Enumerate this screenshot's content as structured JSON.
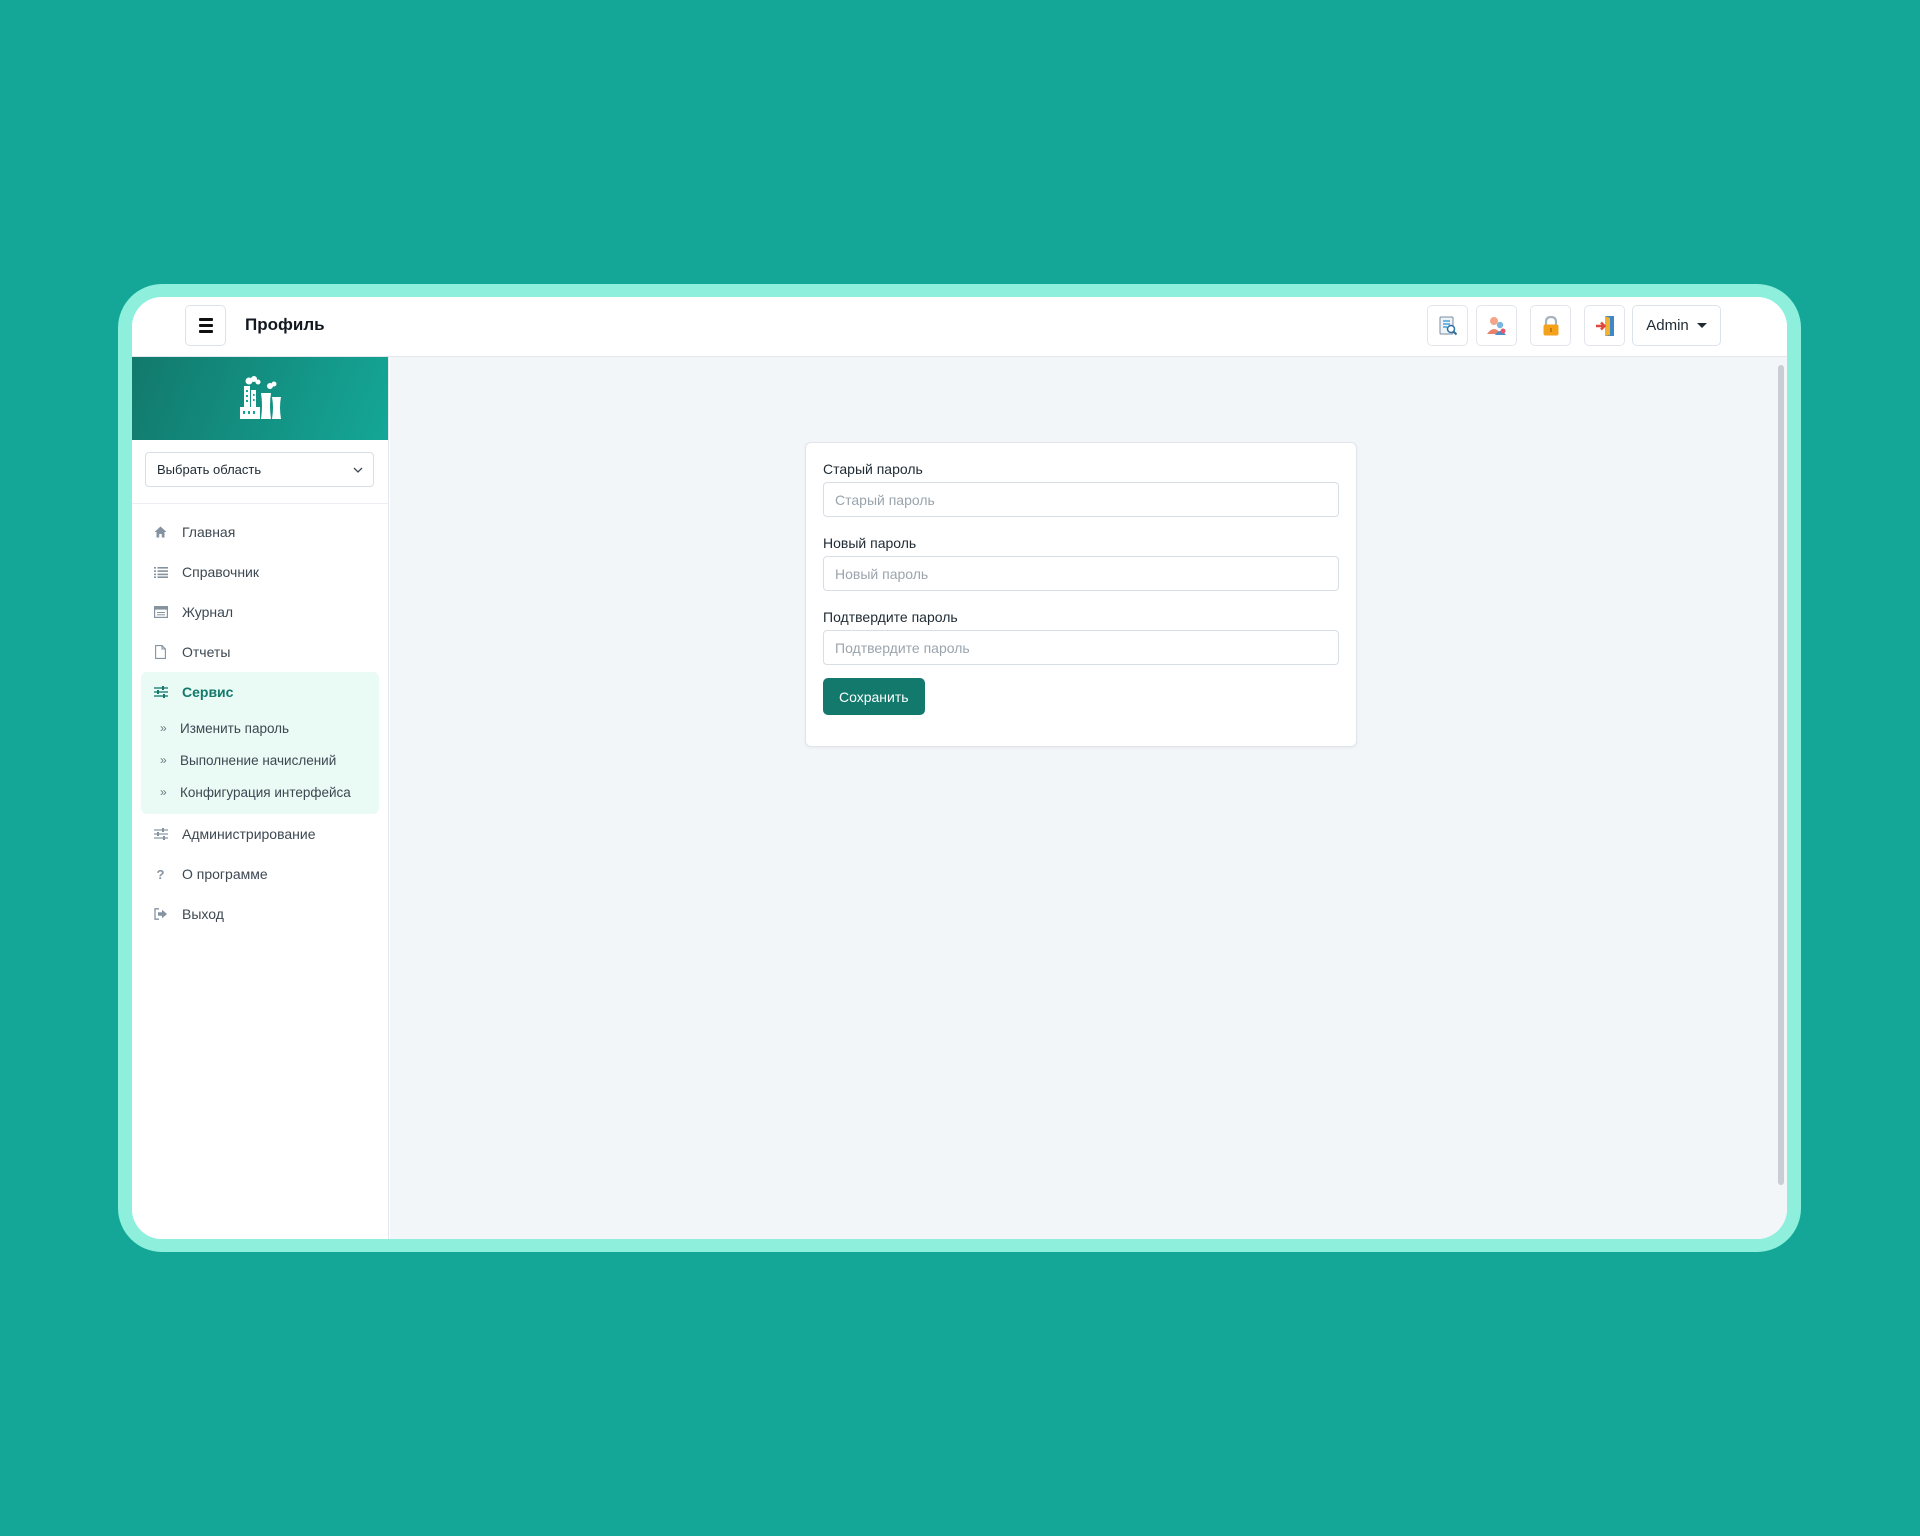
{
  "header": {
    "page_title": "Профиль",
    "user_label": "Admin",
    "tool_icons": [
      "report-search-icon",
      "users-icon",
      "lock-icon",
      "exit-door-icon"
    ]
  },
  "sidebar": {
    "region_select": {
      "value": "Выбрать область"
    },
    "items": [
      {
        "label": "Главная",
        "icon": "home-icon"
      },
      {
        "label": "Справочник",
        "icon": "list-icon"
      },
      {
        "label": "Журнал",
        "icon": "journal-icon"
      },
      {
        "label": "Отчеты",
        "icon": "file-icon"
      },
      {
        "label": "Сервис",
        "icon": "sliders-icon",
        "active": true,
        "children": [
          {
            "label": "Изменить пароль"
          },
          {
            "label": "Выполнение начислений"
          },
          {
            "label": "Конфигурация интерфейса"
          }
        ]
      },
      {
        "label": "Администрирование",
        "icon": "sliders-icon"
      },
      {
        "label": "О программе",
        "icon": "question-icon"
      },
      {
        "label": "Выход",
        "icon": "logout-icon"
      }
    ]
  },
  "form": {
    "old_password": {
      "label": "Старый пароль",
      "placeholder": "Старый пароль"
    },
    "new_password": {
      "label": "Новый пароль",
      "placeholder": "Новый пароль"
    },
    "confirm_password": {
      "label": "Подтвердите пароль",
      "placeholder": "Подтвердите пароль"
    },
    "submit_label": "Сохранить"
  },
  "colors": {
    "background": "#14a797",
    "frame": "#8ef0dc",
    "accent": "#12796c",
    "active_bg": "#eafaf4",
    "content_bg": "#f3f6f9"
  }
}
